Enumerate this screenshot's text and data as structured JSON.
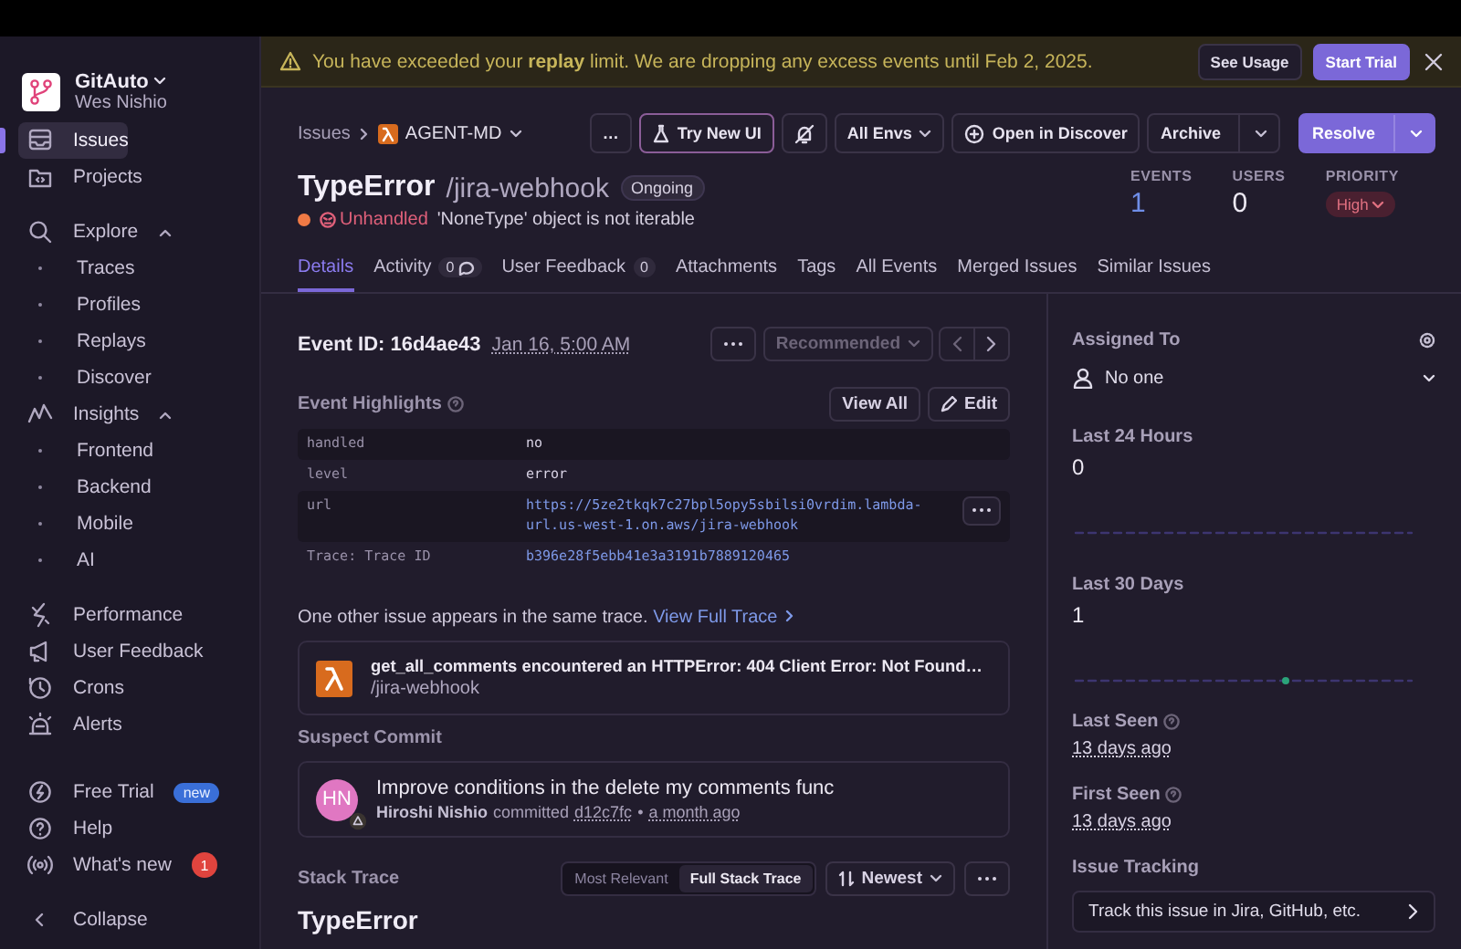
{
  "sidebar": {
    "org": {
      "name": "GitAuto",
      "user": "Wes Nishio"
    },
    "items": [
      {
        "label": "Issues",
        "kind": "item",
        "selected": true
      },
      {
        "label": "Projects",
        "kind": "item",
        "selected": false
      },
      {
        "label": "Explore",
        "kind": "section",
        "expanded": true,
        "selected": false
      },
      {
        "label": "Traces",
        "kind": "sub",
        "selected": false
      },
      {
        "label": "Profiles",
        "kind": "sub",
        "selected": false
      },
      {
        "label": "Replays",
        "kind": "sub",
        "selected": false
      },
      {
        "label": "Discover",
        "kind": "sub",
        "selected": false
      },
      {
        "label": "Insights",
        "kind": "section",
        "expanded": true,
        "selected": false
      },
      {
        "label": "Frontend",
        "kind": "sub",
        "selected": false
      },
      {
        "label": "Backend",
        "kind": "sub",
        "selected": false
      },
      {
        "label": "Mobile",
        "kind": "sub",
        "selected": false
      },
      {
        "label": "AI",
        "kind": "sub",
        "selected": false
      },
      {
        "label": "Performance",
        "kind": "item",
        "selected": false
      },
      {
        "label": "User Feedback",
        "kind": "item",
        "selected": false
      },
      {
        "label": "Crons",
        "kind": "item",
        "selected": false
      },
      {
        "label": "Alerts",
        "kind": "item",
        "selected": false
      }
    ],
    "footer_items": [
      {
        "label": "Free Trial",
        "badge": "new",
        "kind": "promo"
      },
      {
        "label": "Help"
      },
      {
        "label": "What's new",
        "badge": "1",
        "kind": "count"
      },
      {
        "label": "Collapse"
      }
    ]
  },
  "banner": {
    "text": "You have exceeded your **replay** limit. We are dropping any excess events until Feb 2, 2025.",
    "buttons": [
      {
        "label": "See Usage",
        "kind": "secondary"
      },
      {
        "label": "Start Trial",
        "kind": "primary"
      }
    ]
  },
  "breadcrumb": {
    "root": "Issues",
    "project": "AGENT-MD"
  },
  "toolbar": [
    {
      "label": "…",
      "kind": "more"
    },
    {
      "label": "Try New UI",
      "kind": "flask"
    },
    {
      "kind": "mute"
    },
    {
      "label": "All Envs",
      "kind": "dropdown"
    },
    {
      "label": "Open in Discover",
      "kind": "discover"
    },
    {
      "label": "Archive",
      "kind": "split"
    },
    {
      "label": "Resolve",
      "kind": "primary-split"
    }
  ],
  "issue": {
    "title": "TypeError",
    "path": "/jira-webhook",
    "status": "Ongoing",
    "handled_label": "Unhandled",
    "message": "'NoneType' object is not iterable"
  },
  "stats": [
    {
      "label": "EVENTS",
      "value": "1",
      "kind": "link"
    },
    {
      "label": "USERS",
      "value": "0",
      "kind": "plain"
    },
    {
      "label": "PRIORITY",
      "value": "High",
      "kind": "badge"
    }
  ],
  "tabs": [
    {
      "label": "Details",
      "selected": true
    },
    {
      "label": "Activity",
      "count": "0",
      "selected": false
    },
    {
      "label": "User Feedback",
      "count": "0",
      "selected": false
    },
    {
      "label": "Attachments",
      "selected": false
    },
    {
      "label": "Tags",
      "selected": false
    },
    {
      "label": "All Events",
      "selected": false
    },
    {
      "label": "Merged Issues",
      "selected": false
    },
    {
      "label": "Similar Issues",
      "selected": false
    }
  ],
  "event": {
    "id_label": "Event ID:",
    "id": "16d4ae43",
    "date": "Jan 16, 5:00 AM",
    "sort": "Recommended"
  },
  "highlights": {
    "title": "Event Highlights",
    "buttons": [
      "View All",
      "Edit"
    ],
    "rows": [
      {
        "key": "handled",
        "value": "no",
        "kind": "plain"
      },
      {
        "key": "level",
        "value": "error",
        "kind": "plain"
      },
      {
        "key": "url",
        "value": "https://5ze2tkqk7c27bpl5opy5sbilsi0vrdim.lambda-url.us-west-1.on.aws/jira-webhook",
        "kind": "link"
      },
      {
        "key": "Trace: Trace ID",
        "value": "b396e28f5ebb41e3a3191b7889120465",
        "kind": "link"
      }
    ]
  },
  "trace_notice": {
    "text": "One other issue appears in the same trace.",
    "link": "View Full Trace"
  },
  "related_issue": {
    "title": "get_all_comments encountered an HTTPError: 404 Client Error: Not Found…",
    "path": "/jira-webhook"
  },
  "suspect_commit": {
    "title": "Suspect Commit",
    "initials": "HN",
    "message": "Improve conditions in the delete my comments func",
    "author": "Hiroshi Nishio",
    "verb": "committed",
    "hash": "d12c7fc",
    "separator": "•",
    "time": "a month ago"
  },
  "stack_trace": {
    "title": "Stack Trace",
    "options": [
      {
        "label": "Most Relevant",
        "selected": false
      },
      {
        "label": "Full Stack Trace",
        "selected": true
      }
    ],
    "sort": "Newest",
    "exception": "TypeError"
  },
  "side": {
    "assigned_label": "Assigned To",
    "assignee": "No one",
    "metrics": [
      {
        "label": "Last 24 Hours",
        "value": "0"
      },
      {
        "label": "Last 30 Days",
        "value": "1"
      }
    ],
    "seen": [
      {
        "label": "Last Seen",
        "value": "13 days ago"
      },
      {
        "label": "First Seen",
        "value": "13 days ago"
      }
    ],
    "tracking_label": "Issue Tracking",
    "tracking_button": "Track this issue in Jira, GitHub, etc."
  }
}
